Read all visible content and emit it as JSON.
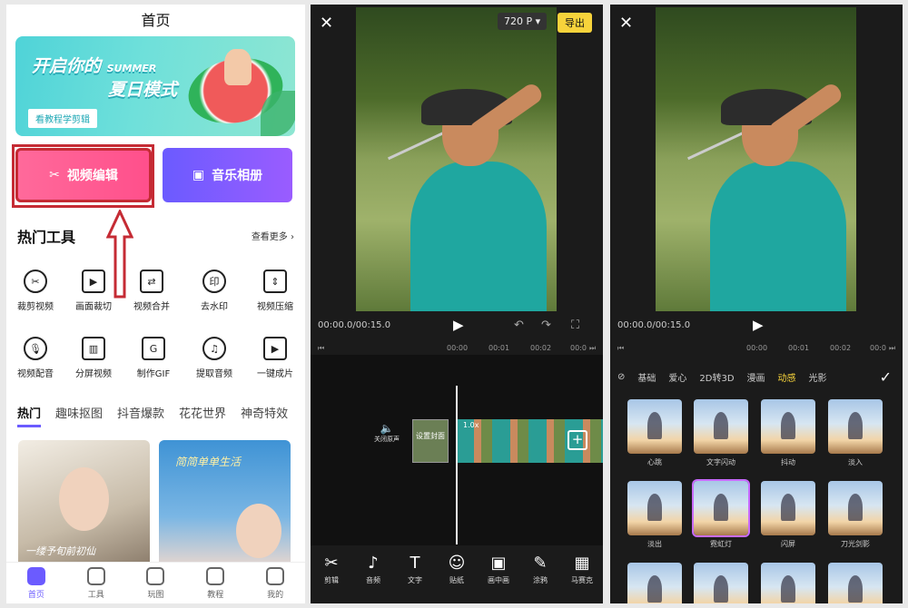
{
  "home": {
    "title": "首页",
    "banner": {
      "line1_a": "开启你的",
      "line1_b": "SUMMER",
      "line2": "夏日模式",
      "button": "看教程学剪辑"
    },
    "video_edit": "视频编辑",
    "music_album": "音乐相册",
    "section_title": "热门工具",
    "more": "查看更多",
    "tools": [
      "裁剪视频",
      "画面裁切",
      "视频合并",
      "去水印",
      "视频压缩",
      "视频配音",
      "分屏视频",
      "制作GIF",
      "提取音频",
      "一键成片"
    ],
    "tabs": [
      "热门",
      "趣味抠图",
      "抖音爆款",
      "花花世界",
      "神奇特效"
    ],
    "card2_text": "简简单单生活",
    "card1_text": "一缕予旬前初仙",
    "nav": [
      "首页",
      "工具",
      "玩图",
      "教程",
      "我的"
    ]
  },
  "editor": {
    "resolution": "720 P",
    "export": "导出",
    "timecode": "00:00.0/00:15.0",
    "ruler": [
      "00:00",
      "00:01",
      "00:02",
      "00:0"
    ],
    "mute": "关闭原声",
    "cover": "设置封面",
    "speed": "1.0x",
    "toolbar": [
      "剪辑",
      "音频",
      "文字",
      "贴纸",
      "画中画",
      "涂鸦",
      "马赛克"
    ]
  },
  "effects": {
    "timecode": "00:00.0/00:15.0",
    "ruler": [
      "00:00",
      "00:01",
      "00:02",
      "00:0"
    ],
    "tabs": [
      "基础",
      "爱心",
      "2D转3D",
      "漫画",
      "动感",
      "光影"
    ],
    "active_tab": "动感",
    "items": [
      "心跳",
      "文字闪动",
      "抖动",
      "淡入",
      "淡出",
      "霓虹灯",
      "闪屏",
      "刀光剑影"
    ],
    "selected": "霓虹灯"
  }
}
